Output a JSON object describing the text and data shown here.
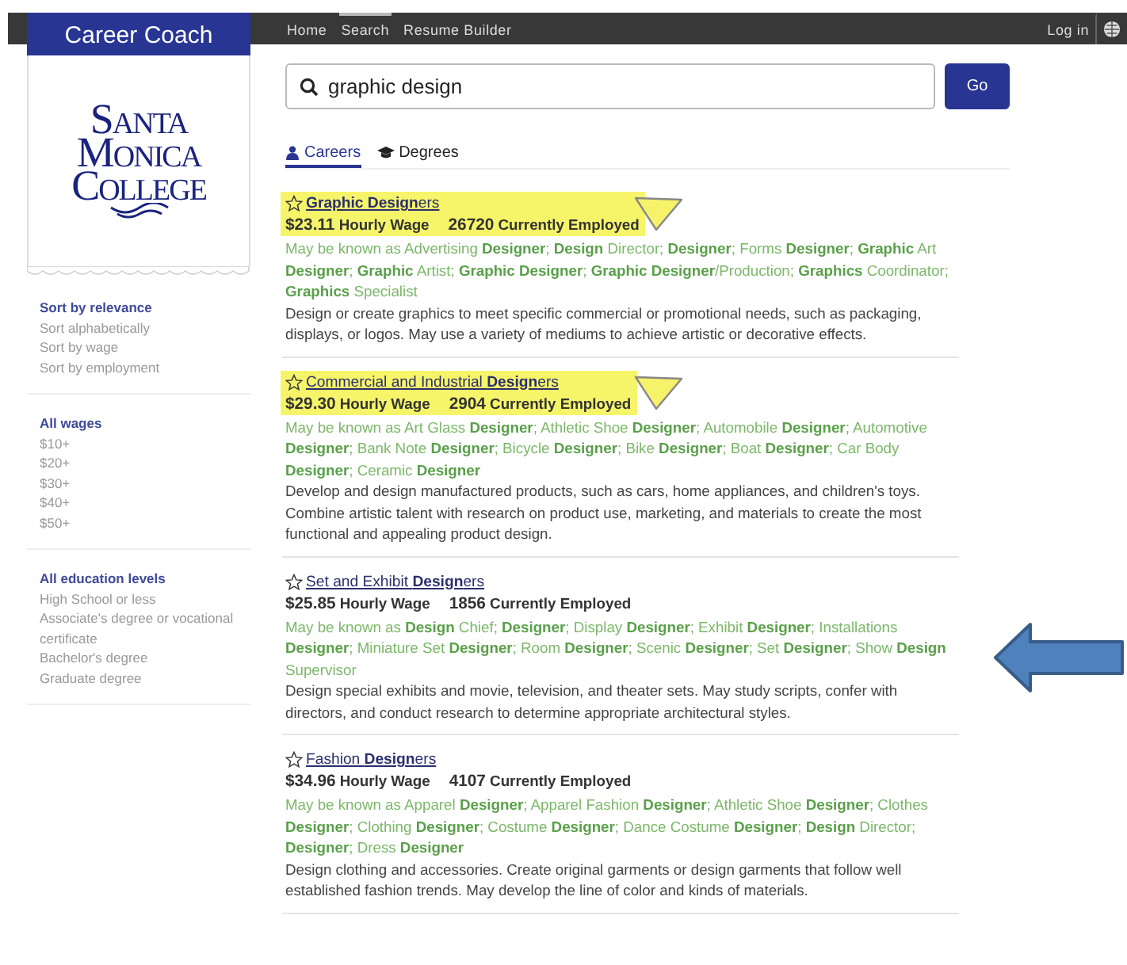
{
  "nav": {
    "brand": "Career Coach",
    "links": [
      {
        "label": "Home",
        "selected": false
      },
      {
        "label": "Search",
        "selected": true
      },
      {
        "label": "Resume Builder",
        "selected": false
      }
    ],
    "login": "Log in"
  },
  "logo": {
    "lines": [
      "Santa",
      "Monica",
      "College"
    ]
  },
  "search": {
    "value": "graphic design",
    "button": "Go"
  },
  "tabs": [
    {
      "label": "Careers",
      "kind": "person",
      "selected": true
    },
    {
      "label": "Degrees",
      "kind": "cap",
      "selected": false
    }
  ],
  "sidebar": [
    {
      "items": [
        {
          "label": "Sort by relevance",
          "selected": true
        },
        {
          "label": "Sort alphabetically",
          "selected": false
        },
        {
          "label": "Sort by wage",
          "selected": false
        },
        {
          "label": "Sort by employment",
          "selected": false
        }
      ]
    },
    {
      "items": [
        {
          "label": "All wages",
          "selected": true
        },
        {
          "label": "$10+",
          "selected": false
        },
        {
          "label": "$20+",
          "selected": false
        },
        {
          "label": "$30+",
          "selected": false
        },
        {
          "label": "$40+",
          "selected": false
        },
        {
          "label": "$50+",
          "selected": false
        }
      ]
    },
    {
      "items": [
        {
          "label": "All education levels",
          "selected": true
        },
        {
          "label": "High School or less",
          "selected": false
        },
        {
          "label": "Associate's degree or vocational certificate",
          "selected": false
        },
        {
          "label": "Bachelor's degree",
          "selected": false
        },
        {
          "label": "Graduate degree",
          "selected": false
        }
      ]
    }
  ],
  "results": [
    {
      "title": "**Graphic Design**ers",
      "wage": "$23.11",
      "wage_label": "Hourly Wage",
      "employed": "26720",
      "employed_label": "Currently Employed",
      "aka": "May be known as Advertising **Designer**; **Design** Director; **Designer**; Forms **Designer**; **Graphic** Art **Designer**; **Graphic** Artist; **Graphic Designer**; **Graphic Designer**/Production; **Graphics** Coordinator; **Graphics** Specialist",
      "description": "Design or create graphics to meet specific commercial or promotional needs, such as packaging, displays, or logos. May use a variety of mediums to achieve artistic or decorative effects.",
      "highlighted": true,
      "arrow": false
    },
    {
      "title": "Commercial and Industrial **Design**ers",
      "wage": "$29.30",
      "wage_label": "Hourly Wage",
      "employed": "2904",
      "employed_label": "Currently Employed",
      "aka": "May be known as Art Glass **Designer**; Athletic Shoe **Designer**; Automobile **Designer**; Automotive **Designer**; Bank Note **Designer**; Bicycle **Designer**; Bike **Designer**; Boat **Designer**; Car Body **Designer**; Ceramic **Designer**",
      "description": "Develop and design manufactured products, such as cars, home appliances, and children's toys. Combine artistic talent with research on product use, marketing, and materials to create the most functional and appealing product design.",
      "highlighted": true,
      "arrow": false
    },
    {
      "title": "Set and Exhibit **Design**ers",
      "wage": "$25.85",
      "wage_label": "Hourly Wage",
      "employed": "1856",
      "employed_label": "Currently Employed",
      "aka": "May be known as **Design** Chief; **Designer**; Display **Designer**; Exhibit **Designer**; Installations **Designer**; Miniature Set **Designer**; Room **Designer**; Scenic **Designer**; Set **Designer**; Show **Design** Supervisor",
      "description": "Design special exhibits and movie, television, and theater sets. May study scripts, confer with directors, and conduct research to determine appropriate architectural styles.",
      "highlighted": false,
      "arrow": true
    },
    {
      "title": "Fashion **Design**ers",
      "wage": "$34.96",
      "wage_label": "Hourly Wage",
      "employed": "4107",
      "employed_label": "Currently Employed",
      "aka": "May be known as Apparel **Designer**; Apparel Fashion **Designer**; Athletic Shoe **Designer**; Clothes **Designer**; Clothing **Designer**; Costume **Designer**; Dance Costume **Designer**; **Design** Director; **Designer**; Dress **Designer**",
      "description": "Design clothing and accessories. Create original garments or design garments that follow well established fashion trends. May develop the line of color and kinds of materials.",
      "highlighted": false,
      "arrow": false
    }
  ]
}
